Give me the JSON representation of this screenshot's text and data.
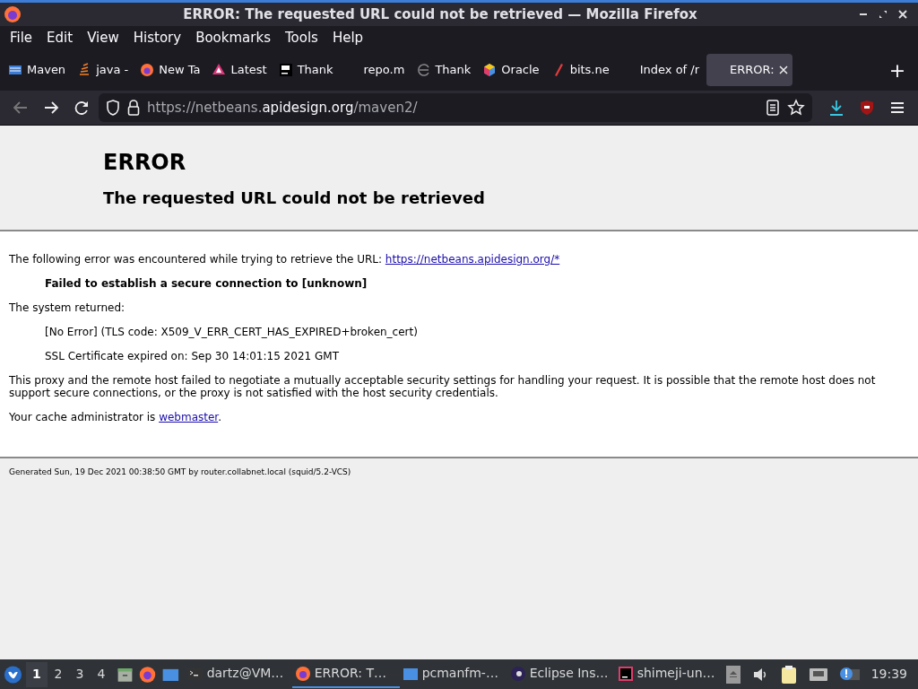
{
  "window": {
    "title": "ERROR: The requested URL could not be retrieved — Mozilla Firefox"
  },
  "menu": [
    "File",
    "Edit",
    "View",
    "History",
    "Bookmarks",
    "Tools",
    "Help"
  ],
  "tabs": [
    {
      "label": "Maven",
      "selected": false
    },
    {
      "label": "java -",
      "selected": false
    },
    {
      "label": "New Ta",
      "selected": false
    },
    {
      "label": "Latest",
      "selected": false
    },
    {
      "label": "Thank",
      "selected": false
    },
    {
      "label": "repo.m",
      "selected": false
    },
    {
      "label": "Thank",
      "selected": false
    },
    {
      "label": "Oracle",
      "selected": false
    },
    {
      "label": "bits.ne",
      "selected": false
    },
    {
      "label": "Index of /r",
      "selected": false
    },
    {
      "label": "ERROR:",
      "selected": true
    }
  ],
  "new_tab": "+",
  "address_bar": {
    "prefix": "https://netbeans.",
    "domain": "apidesign.org",
    "path": "/maven2/"
  },
  "page": {
    "heading": "ERROR",
    "subheading": "The requested URL could not be retrieved",
    "intro": {
      "text": "The following error was encountered while trying to retrieve the URL: ",
      "link": "https://netbeans.apidesign.org/*"
    },
    "error": "Failed to establish a secure connection to [unknown]",
    "system_returned": "The system returned:",
    "details": [
      "[No Error] (TLS code: X509_V_ERR_CERT_HAS_EXPIRED+broken_cert)",
      "SSL Certificate expired on: Sep 30 14:01:15 2021 GMT"
    ],
    "explanation": "This proxy and the remote host failed to negotiate a mutually acceptable security settings for handling your request. It is possible that the remote host does not support secure connections, or the proxy is not satisfied with the host security credentials.",
    "admin": {
      "text": "Your cache administrator is ",
      "link": "webmaster",
      "after": "."
    },
    "footer": "Generated Sun, 19 Dec 2021 00:38:50 GMT by router.collabnet.local (squid/5.2-VCS)"
  },
  "taskbar": {
    "workspaces": [
      {
        "label": "1",
        "selected": true
      },
      {
        "label": "2",
        "selected": false
      },
      {
        "label": "3",
        "selected": false
      },
      {
        "label": "4",
        "selected": false
      }
    ],
    "tasks": [
      {
        "label": "dartz@VM…",
        "selected": false
      },
      {
        "label": "ERROR: T…",
        "selected": true
      },
      {
        "label": "pcmanfm-…",
        "selected": false
      },
      {
        "label": "Eclipse Ins…",
        "selected": false
      },
      {
        "label": "shimeji-un…",
        "selected": false
      }
    ],
    "clock": "19:39"
  }
}
